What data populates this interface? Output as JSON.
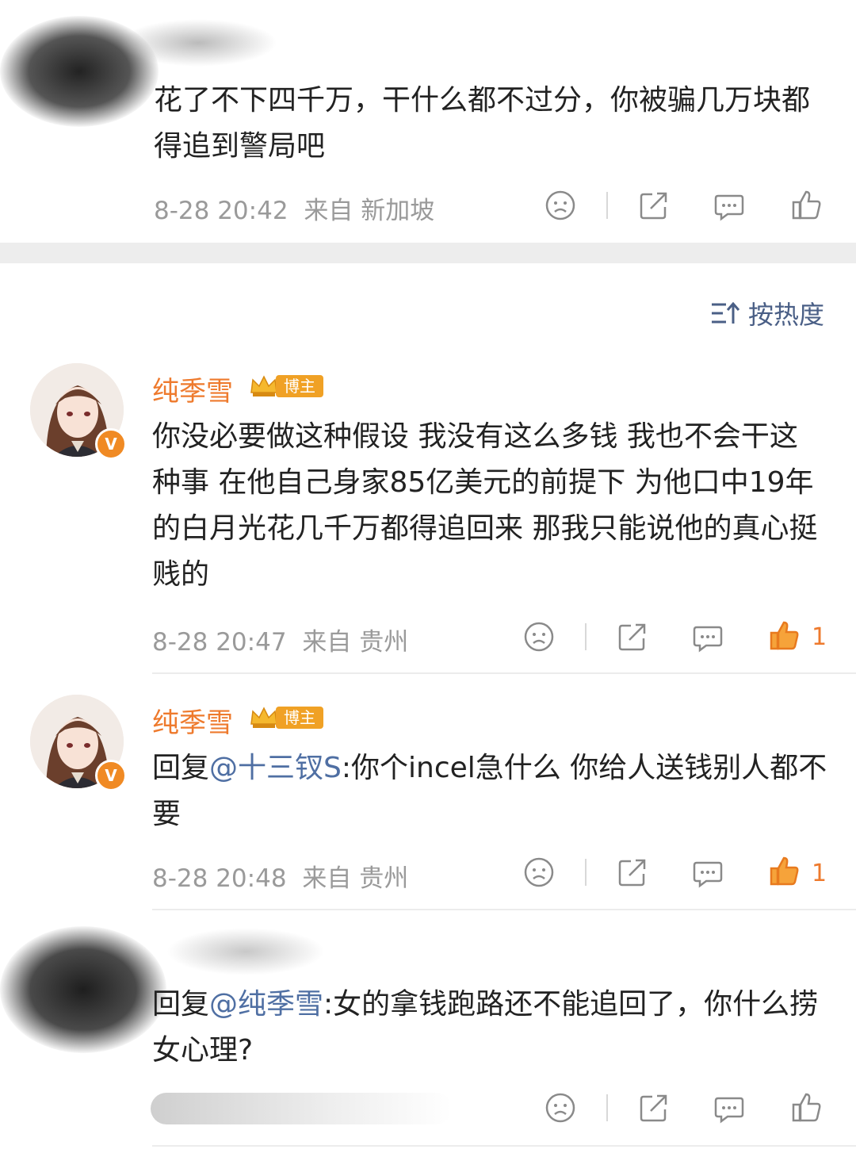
{
  "comments": [
    {
      "text": "花了不下四千万，干什么都不过分，你被骗几万块都得追到警局吧",
      "time": "8-28 20:42",
      "location": "来自 新加坡"
    },
    {
      "username": "纯季雪",
      "badge": "博主",
      "verified": "V",
      "text": "你没必要做这种假设 我没有这么多钱 我也不会干这种事 在他自己身家85亿美元的前提下 为他口中19年的白月光花几千万都得追回来 那我只能说他的真心挺贱的",
      "time": "8-28 20:47",
      "location": "来自 贵州",
      "likes": "1"
    },
    {
      "username": "纯季雪",
      "badge": "博主",
      "verified": "V",
      "reply_prefix": "回复",
      "mention": "@十三钗S",
      "text": ":你个incel急什么 你给人送钱别人都不要",
      "time": "8-28 20:48",
      "location": "来自 贵州",
      "likes": "1"
    },
    {
      "reply_prefix": "回复",
      "mention": "@纯季雪",
      "text": ":女的拿钱跑路还不能追回了，你什么捞女心理?"
    }
  ],
  "sort": {
    "label": "按热度",
    "icon": "sort-icon"
  },
  "colors": {
    "accent": "#ee7a2d",
    "link": "#4f6fa3",
    "meta": "#9a9a9a",
    "badge": "#f0a125"
  }
}
